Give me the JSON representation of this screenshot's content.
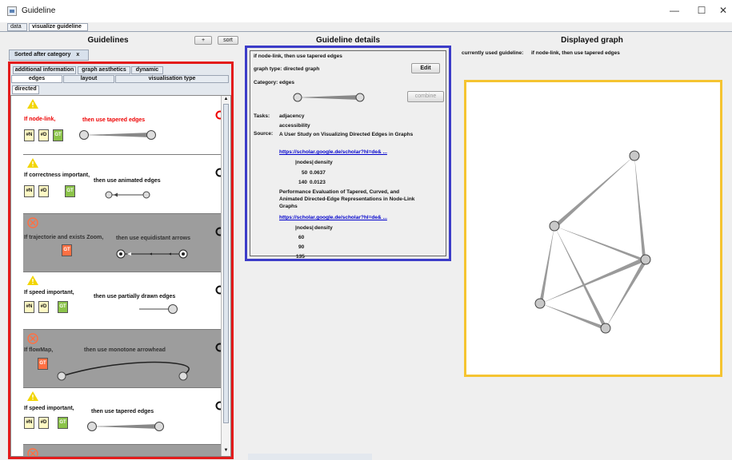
{
  "window": {
    "title": "Guideline",
    "minimize": "—",
    "maximize": "☐",
    "close": "✕"
  },
  "top_tabs": [
    "data",
    "visualize guideline"
  ],
  "left": {
    "header": "Guidelines",
    "add_button": "+",
    "sort_button": "sort",
    "sorted_tab": "Sorted after category",
    "sorted_tab_close": "x",
    "category_tabs_row1": [
      "additional information",
      "graph aesthetics",
      "dynamic"
    ],
    "category_tabs_row2": [
      "edges",
      "layout",
      "visualisation type"
    ],
    "inner_tab": "directed",
    "cards": [
      {
        "condition": "If node-link,",
        "consequence": "then use tapered edges",
        "badges": [
          "#N",
          "#D",
          "GT"
        ],
        "status": "warning",
        "selected": true
      },
      {
        "condition": "If correctness important,",
        "consequence": "then use animated edges",
        "badges": [
          "#N",
          "#D",
          "GT"
        ],
        "status": "warning",
        "selected": false
      },
      {
        "condition": "If trajectorie and exists Zoom,",
        "consequence": "then use equidistant arrows",
        "badges": [
          "GT"
        ],
        "status": "invalid",
        "selected": false
      },
      {
        "condition": "If speed important,",
        "consequence": "then use partially drawn edges",
        "badges": [
          "#N",
          "#D",
          "GT"
        ],
        "status": "warning",
        "selected": false
      },
      {
        "condition": "If flowMap,",
        "consequence": "then use monotone arrowhead",
        "badges": [
          "GT"
        ],
        "status": "invalid",
        "selected": false
      },
      {
        "condition": "If speed important,",
        "consequence": "then use tapered edges",
        "badges": [
          "#N",
          "#D",
          "GT"
        ],
        "status": "warning",
        "selected": false
      }
    ]
  },
  "details": {
    "header": "Guideline details",
    "title": "if node-link, then use tapered edges",
    "graph_type": "graph type: directed graph",
    "edit_button": "Edit",
    "category": "Category: edges",
    "combine_button": "combine",
    "tasks_label": "Tasks:",
    "tasks": [
      "adjacency",
      "accessibility"
    ],
    "source_label": "Source:",
    "source1_title": "A User Study on Visualizing Directed Edges in Graphs",
    "source1_link": "https://scholar.google.de/scholar?hl=de& ...",
    "source1_table_header": [
      "|nodes|",
      "density"
    ],
    "source1_rows": [
      [
        "50",
        "0.0637"
      ],
      [
        "140",
        "0.0123"
      ]
    ],
    "source2_title": "Performance Evaluation of Tapered, Curved, and Animated Directed-Edge Representations in Node-Link Graphs",
    "source2_link": "https://scholar.google.de/scholar?hl=de& ...",
    "source2_table_header": [
      "|nodes|",
      "density"
    ],
    "source2_rows": [
      "60",
      "90",
      "135"
    ]
  },
  "graph": {
    "header": "Displayed graph",
    "current_label": "currently used guideline:",
    "current_value": "if node-link, then use tapered edges"
  },
  "colors": {
    "red_box": "#e31b1b",
    "blue_box": "#3c3cc8",
    "yellow_box": "#f5c431",
    "warning": "#f2d500",
    "invalid": "#ff7043"
  }
}
